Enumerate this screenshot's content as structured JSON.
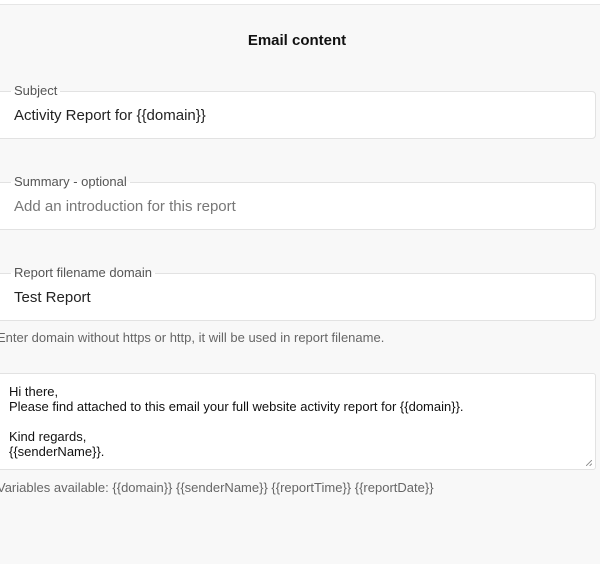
{
  "section_title": "Email content",
  "subject": {
    "label": "Subject",
    "value": "Activity Report for {{domain}}"
  },
  "summary": {
    "label": "Summary - optional",
    "placeholder": "Add an introduction for this report"
  },
  "filename": {
    "label": "Report filename domain",
    "value": "Test Report",
    "helper": "Enter domain without https or http, it will be used in report filename."
  },
  "body": {
    "value": "Hi there,\nPlease find attached to this email your full website activity report for {{domain}}.\n\nKind regards,\n{{senderName}}.",
    "helper": "Variables available: {{domain}} {{senderName}} {{reportTime}} {{reportDate}}"
  }
}
